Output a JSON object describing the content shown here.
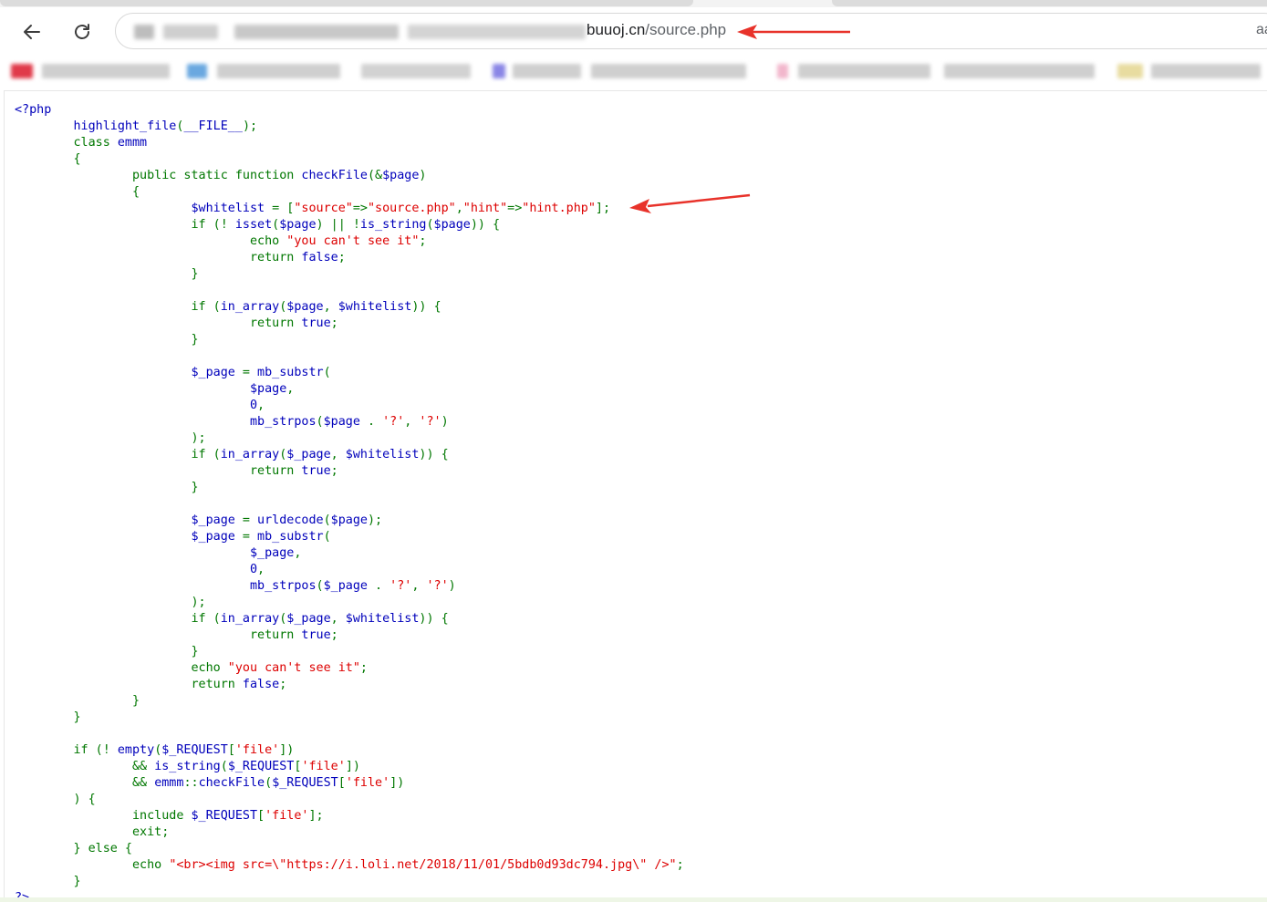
{
  "browser": {
    "url_domain": "buuoj.cn",
    "url_path": "/source.php",
    "omnibox_trailing": "aa",
    "icons": {
      "back": "back-arrow-icon",
      "reload": "reload-icon"
    }
  },
  "code_lines": [
    [
      [
        "df",
        "<?php"
      ]
    ],
    [
      [
        "df",
        "        highlight_file"
      ],
      [
        "kw",
        "("
      ],
      [
        "df",
        "__FILE__"
      ],
      [
        "kw",
        ");"
      ]
    ],
    [
      [
        "kw",
        "        class "
      ],
      [
        "df",
        "emmm"
      ]
    ],
    [
      [
        "kw",
        "        {"
      ]
    ],
    [
      [
        "kw",
        "                public static function "
      ],
      [
        "df",
        "checkFile"
      ],
      [
        "kw",
        "(&"
      ],
      [
        "df",
        "$page"
      ],
      [
        "kw",
        ")"
      ]
    ],
    [
      [
        "kw",
        "                {"
      ]
    ],
    [
      [
        "df",
        "                        $whitelist "
      ],
      [
        "kw",
        "= ["
      ],
      [
        "st",
        "\"source\""
      ],
      [
        "kw",
        "=>"
      ],
      [
        "st",
        "\"source.php\""
      ],
      [
        "kw",
        ","
      ],
      [
        "st",
        "\"hint\""
      ],
      [
        "kw",
        "=>"
      ],
      [
        "st",
        "\"hint.php\""
      ],
      [
        "kw",
        "];"
      ]
    ],
    [
      [
        "kw",
        "                        if (! "
      ],
      [
        "df",
        "isset"
      ],
      [
        "kw",
        "("
      ],
      [
        "df",
        "$page"
      ],
      [
        "kw",
        ") || !"
      ],
      [
        "df",
        "is_string"
      ],
      [
        "kw",
        "("
      ],
      [
        "df",
        "$page"
      ],
      [
        "kw",
        ")) {"
      ]
    ],
    [
      [
        "kw",
        "                                echo "
      ],
      [
        "st",
        "\"you can't see it\""
      ],
      [
        "kw",
        ";"
      ]
    ],
    [
      [
        "kw",
        "                                return "
      ],
      [
        "df",
        "false"
      ],
      [
        "kw",
        ";"
      ]
    ],
    [
      [
        "kw",
        "                        }"
      ]
    ],
    [
      [
        "kw",
        ""
      ]
    ],
    [
      [
        "kw",
        "                        if ("
      ],
      [
        "df",
        "in_array"
      ],
      [
        "kw",
        "("
      ],
      [
        "df",
        "$page"
      ],
      [
        "kw",
        ", "
      ],
      [
        "df",
        "$whitelist"
      ],
      [
        "kw",
        ")) {"
      ]
    ],
    [
      [
        "kw",
        "                                return "
      ],
      [
        "df",
        "true"
      ],
      [
        "kw",
        ";"
      ]
    ],
    [
      [
        "kw",
        "                        }"
      ]
    ],
    [
      [
        "kw",
        ""
      ]
    ],
    [
      [
        "df",
        "                        $_page "
      ],
      [
        "kw",
        "= "
      ],
      [
        "df",
        "mb_substr"
      ],
      [
        "kw",
        "("
      ]
    ],
    [
      [
        "df",
        "                                $page"
      ],
      [
        "kw",
        ","
      ]
    ],
    [
      [
        "df",
        "                                0"
      ],
      [
        "kw",
        ","
      ]
    ],
    [
      [
        "df",
        "                                mb_strpos"
      ],
      [
        "kw",
        "("
      ],
      [
        "df",
        "$page "
      ],
      [
        "kw",
        ". "
      ],
      [
        "st",
        "'?'"
      ],
      [
        "kw",
        ", "
      ],
      [
        "st",
        "'?'"
      ],
      [
        "kw",
        ")"
      ]
    ],
    [
      [
        "kw",
        "                        );"
      ]
    ],
    [
      [
        "kw",
        "                        if ("
      ],
      [
        "df",
        "in_array"
      ],
      [
        "kw",
        "("
      ],
      [
        "df",
        "$_page"
      ],
      [
        "kw",
        ", "
      ],
      [
        "df",
        "$whitelist"
      ],
      [
        "kw",
        ")) {"
      ]
    ],
    [
      [
        "kw",
        "                                return "
      ],
      [
        "df",
        "true"
      ],
      [
        "kw",
        ";"
      ]
    ],
    [
      [
        "kw",
        "                        }"
      ]
    ],
    [
      [
        "kw",
        ""
      ]
    ],
    [
      [
        "df",
        "                        $_page "
      ],
      [
        "kw",
        "= "
      ],
      [
        "df",
        "urldecode"
      ],
      [
        "kw",
        "("
      ],
      [
        "df",
        "$page"
      ],
      [
        "kw",
        ");"
      ]
    ],
    [
      [
        "df",
        "                        $_page "
      ],
      [
        "kw",
        "= "
      ],
      [
        "df",
        "mb_substr"
      ],
      [
        "kw",
        "("
      ]
    ],
    [
      [
        "df",
        "                                $_page"
      ],
      [
        "kw",
        ","
      ]
    ],
    [
      [
        "df",
        "                                0"
      ],
      [
        "kw",
        ","
      ]
    ],
    [
      [
        "df",
        "                                mb_strpos"
      ],
      [
        "kw",
        "("
      ],
      [
        "df",
        "$_page "
      ],
      [
        "kw",
        ". "
      ],
      [
        "st",
        "'?'"
      ],
      [
        "kw",
        ", "
      ],
      [
        "st",
        "'?'"
      ],
      [
        "kw",
        ")"
      ]
    ],
    [
      [
        "kw",
        "                        );"
      ]
    ],
    [
      [
        "kw",
        "                        if ("
      ],
      [
        "df",
        "in_array"
      ],
      [
        "kw",
        "("
      ],
      [
        "df",
        "$_page"
      ],
      [
        "kw",
        ", "
      ],
      [
        "df",
        "$whitelist"
      ],
      [
        "kw",
        ")) {"
      ]
    ],
    [
      [
        "kw",
        "                                return "
      ],
      [
        "df",
        "true"
      ],
      [
        "kw",
        ";"
      ]
    ],
    [
      [
        "kw",
        "                        }"
      ]
    ],
    [
      [
        "kw",
        "                        echo "
      ],
      [
        "st",
        "\"you can't see it\""
      ],
      [
        "kw",
        ";"
      ]
    ],
    [
      [
        "kw",
        "                        return "
      ],
      [
        "df",
        "false"
      ],
      [
        "kw",
        ";"
      ]
    ],
    [
      [
        "kw",
        "                }"
      ]
    ],
    [
      [
        "kw",
        "        }"
      ]
    ],
    [
      [
        "kw",
        ""
      ]
    ],
    [
      [
        "kw",
        "        if (! "
      ],
      [
        "df",
        "empty"
      ],
      [
        "kw",
        "("
      ],
      [
        "df",
        "$_REQUEST"
      ],
      [
        "kw",
        "["
      ],
      [
        "st",
        "'file'"
      ],
      [
        "kw",
        "])"
      ]
    ],
    [
      [
        "kw",
        "                && "
      ],
      [
        "df",
        "is_string"
      ],
      [
        "kw",
        "("
      ],
      [
        "df",
        "$_REQUEST"
      ],
      [
        "kw",
        "["
      ],
      [
        "st",
        "'file'"
      ],
      [
        "kw",
        "])"
      ]
    ],
    [
      [
        "kw",
        "                && "
      ],
      [
        "df",
        "emmm"
      ],
      [
        "kw",
        "::"
      ],
      [
        "df",
        "checkFile"
      ],
      [
        "kw",
        "("
      ],
      [
        "df",
        "$_REQUEST"
      ],
      [
        "kw",
        "["
      ],
      [
        "st",
        "'file'"
      ],
      [
        "kw",
        "])"
      ]
    ],
    [
      [
        "kw",
        "        ) {"
      ]
    ],
    [
      [
        "kw",
        "                include "
      ],
      [
        "df",
        "$_REQUEST"
      ],
      [
        "kw",
        "["
      ],
      [
        "st",
        "'file'"
      ],
      [
        "kw",
        "];"
      ]
    ],
    [
      [
        "kw",
        "                exit;"
      ]
    ],
    [
      [
        "kw",
        "        } else {"
      ]
    ],
    [
      [
        "kw",
        "                echo "
      ],
      [
        "st",
        "\"<br><img src=\\\"https://i.loli.net/2018/11/01/5bdb0d93dc794.jpg\\\" />\""
      ],
      [
        "kw",
        ";"
      ]
    ],
    [
      [
        "kw",
        "        }"
      ]
    ],
    [
      [
        "df",
        "?>"
      ]
    ]
  ],
  "colors": {
    "keyword": "#007700",
    "default": "#0000bb",
    "string": "#dd0000",
    "annotation_arrow": "#e8322a"
  }
}
